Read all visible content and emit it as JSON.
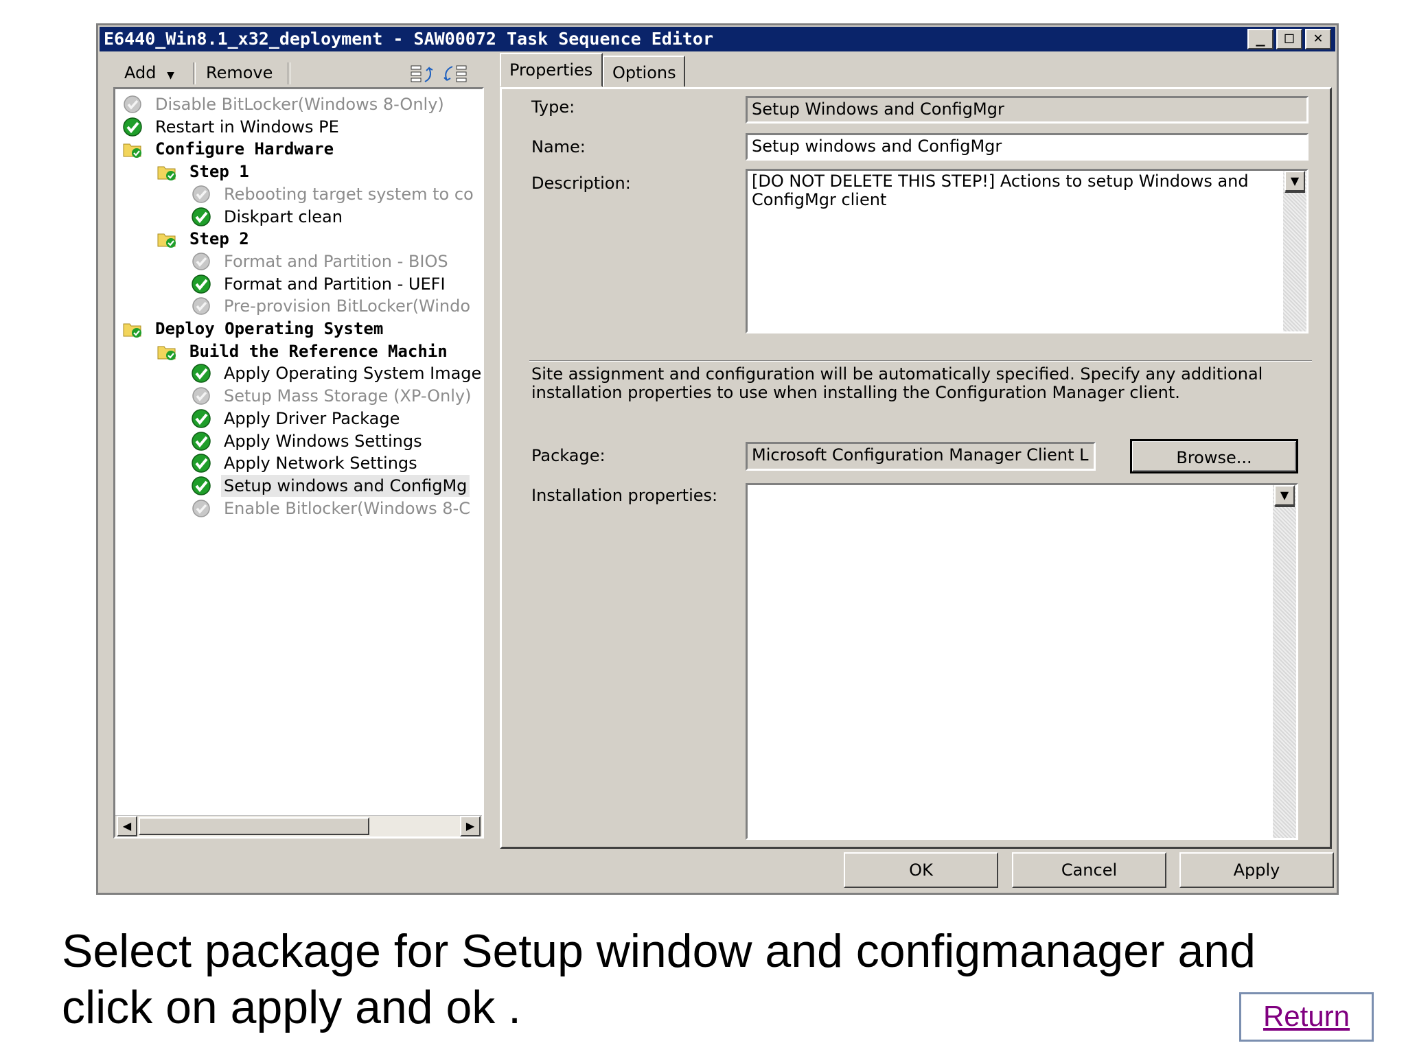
{
  "window": {
    "title": "E6440_Win8.1_x32_deployment - SAW00072 Task Sequence Editor",
    "controls": [
      "_",
      "□",
      "✕"
    ]
  },
  "toolbar": {
    "add_label": "Add",
    "remove_label": "Remove"
  },
  "tree": {
    "items": [
      {
        "label": "Disable BitLocker(Windows 8-Only)",
        "state": "disabled",
        "icon": "disabled-step-icon"
      },
      {
        "label": "Restart in Windows PE",
        "state": "enabled",
        "icon": "check-icon"
      },
      {
        "label": "Configure Hardware",
        "state": "group",
        "icon": "folder-icon"
      },
      {
        "label": "Step 1",
        "state": "group",
        "icon": "folder-icon"
      },
      {
        "label": "Rebooting target system to co",
        "state": "disabled",
        "icon": "disabled-step-icon"
      },
      {
        "label": "Diskpart clean",
        "state": "enabled",
        "icon": "check-icon"
      },
      {
        "label": "Step 2",
        "state": "group",
        "icon": "folder-icon"
      },
      {
        "label": "Format and Partition - BIOS",
        "state": "disabled",
        "icon": "disabled-step-icon"
      },
      {
        "label": "Format and Partition - UEFI",
        "state": "enabled",
        "icon": "check-icon"
      },
      {
        "label": "Pre-provision BitLocker(Windo",
        "state": "disabled",
        "icon": "disabled-step-icon"
      },
      {
        "label": "Deploy Operating System",
        "state": "group",
        "icon": "folder-icon"
      },
      {
        "label": "Build the Reference Machin",
        "state": "group",
        "icon": "folder-icon"
      },
      {
        "label": "Apply Operating System Image",
        "state": "enabled",
        "icon": "check-icon"
      },
      {
        "label": "Setup Mass Storage (XP-Only)",
        "state": "disabled",
        "icon": "disabled-step-icon"
      },
      {
        "label": "Apply Driver Package",
        "state": "enabled",
        "icon": "check-icon"
      },
      {
        "label": "Apply Windows Settings",
        "state": "enabled",
        "icon": "check-icon"
      },
      {
        "label": "Apply Network Settings",
        "state": "enabled",
        "icon": "check-icon"
      },
      {
        "label": "Setup windows and ConfigMg",
        "state": "selected",
        "icon": "check-icon"
      },
      {
        "label": "Enable Bitlocker(Windows 8-C",
        "state": "disabled",
        "icon": "disabled-step-icon"
      }
    ]
  },
  "tabs": {
    "properties": "Properties",
    "options": "Options"
  },
  "form": {
    "type_label": "Type:",
    "type_value": "Setup Windows and ConfigMgr",
    "name_label": "Name:",
    "name_value": "Setup windows and ConfigMgr",
    "description_label": "Description:",
    "description_value": "[DO NOT DELETE THIS STEP!] Actions to setup Windows and ConfigMgr client",
    "info_text": "Site assignment and configuration will be automatically specified. Specify any additional installation properties to use when installing the Configuration Manager client.",
    "package_label": "Package:",
    "package_value": "Microsoft Configuration Manager Client L",
    "browse_label": "Browse...",
    "install_props_label": "Installation properties:",
    "install_props_value": ""
  },
  "buttons": {
    "ok": "OK",
    "cancel": "Cancel",
    "apply": "Apply"
  },
  "caption": "Select package for Setup window and configmanager and click on apply and ok .",
  "return_link": "Return",
  "colors": {
    "titlebar": "#0a246a",
    "dialog": "#d4d0c8",
    "link": "#800080"
  }
}
